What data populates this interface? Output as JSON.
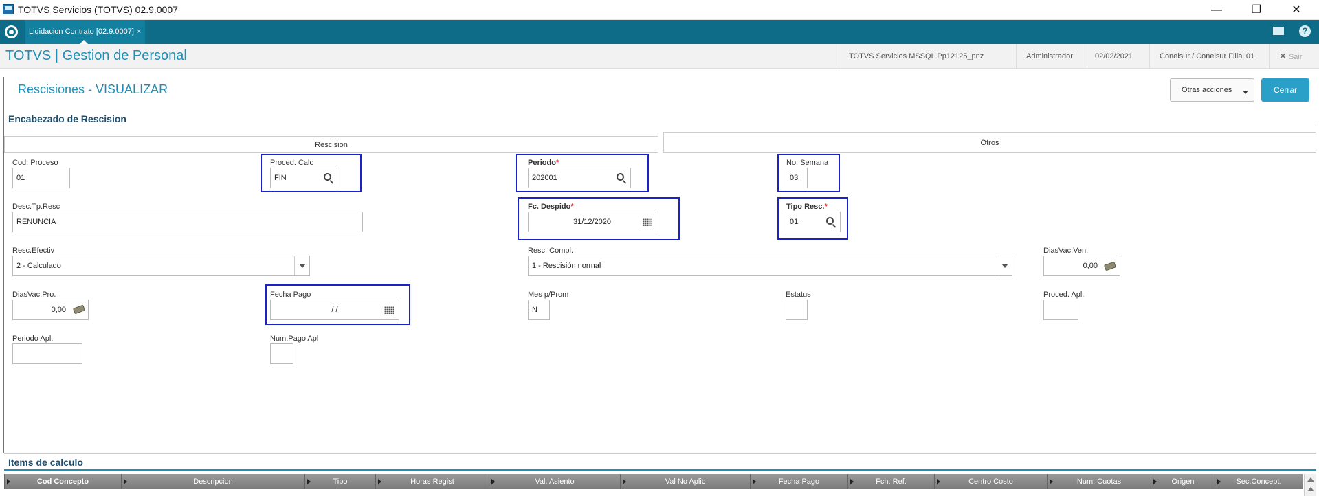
{
  "window": {
    "title": "TOTVS Servicios (TOTVS) 02.9.0007",
    "minimize": "—",
    "restore": "❐",
    "close": "✕"
  },
  "tabbar": {
    "tab_label": "Liqidacion Contrato [02.9.0007]",
    "tab_close": "×",
    "help": "?"
  },
  "header": {
    "brand": "TOTVS | Gestion de Personal",
    "environment": "TOTVS Servicios MSSQL Pp12125_pnz",
    "user": "Administrador",
    "date": "02/02/2021",
    "company": "Conelsur / Conelsur Filial 01",
    "logout_icon": "✕",
    "logout": "Sair"
  },
  "page": {
    "title": "Rescisiones - VISUALIZAR",
    "other_actions": "Otras acciones",
    "close": "Cerrar"
  },
  "section_header": {
    "title": "Encabezado de Rescision",
    "tabs": [
      {
        "label": "Rescision"
      },
      {
        "label": "Otros"
      }
    ]
  },
  "fields": {
    "cod_proceso": {
      "label": "Cod. Proceso",
      "value": "01"
    },
    "proced_calc": {
      "label": "Proced. Calc",
      "value": "FIN"
    },
    "periodo": {
      "label": "Periodo",
      "required": "*",
      "value": "202001"
    },
    "no_semana": {
      "label": "No. Semana",
      "value": "03"
    },
    "desc_tp_resc": {
      "label": "Desc.Tp.Resc",
      "value": "RENUNCIA"
    },
    "fc_despido": {
      "label": "Fc. Despido",
      "required": "*",
      "value": "31/12/2020"
    },
    "tipo_resc": {
      "label": "Tipo Resc.",
      "required": "*",
      "value": "01"
    },
    "resc_efectiv": {
      "label": "Resc.Efectiv",
      "value": "2 - Calculado"
    },
    "resc_compl": {
      "label": "Resc. Compl.",
      "value": "1 - Rescisión normal"
    },
    "dias_vac_ven": {
      "label": "DiasVac.Ven.",
      "value": "0,00"
    },
    "dias_vac_pro": {
      "label": "DiasVac.Pro.",
      "value": "0,00"
    },
    "fecha_pago": {
      "label": "Fecha Pago",
      "value": "/  /"
    },
    "mes_p_prom": {
      "label": "Mes p/Prom",
      "value": "N"
    },
    "estatus": {
      "label": "Estatus",
      "value": ""
    },
    "proced_apl": {
      "label": "Proced. Apl.",
      "value": ""
    },
    "periodo_apl": {
      "label": "Periodo Apl.",
      "value": ""
    },
    "num_pago_apl": {
      "label": "Num.Pago Apl",
      "value": ""
    }
  },
  "items": {
    "title": "Items de calculo",
    "columns": [
      "Cod Concepto",
      "Descripcion",
      "Tipo",
      "Horas Regist",
      "Val. Asiento",
      "Val No Aplic",
      "Fecha Pago",
      "Fch. Ref.",
      "Centro Costo",
      "Num. Cuotas",
      "Origen",
      "Sec.Concept."
    ]
  },
  "colors": {
    "accent": "#1e8fb8",
    "tabbar": "#0f6c88",
    "highlight": "#1a23c8",
    "primary_button": "#2a9fc7"
  }
}
